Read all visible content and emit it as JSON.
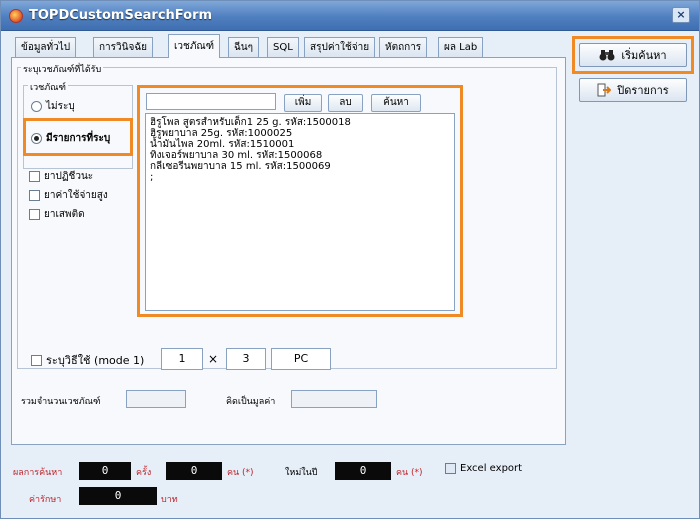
{
  "window": {
    "title": "TOPDCustomSearchForm",
    "close": "×"
  },
  "tabs": [
    {
      "label": "ข้อมูลทั่วไป"
    },
    {
      "label": "การวินิจฉัย"
    },
    {
      "label": "เวชภัณฑ์"
    },
    {
      "label": "ฉีนๆ"
    },
    {
      "label": "SQL"
    },
    {
      "label": "สรุปค่าใช้จ่าย"
    },
    {
      "label": "หัตถการ"
    },
    {
      "label": "ผล Lab"
    }
  ],
  "drug_panel": {
    "group_title": "ระบุเวชภัณฑ์ที่ได้รับ",
    "sub_group_title": "เวชภัณฑ์",
    "radio_none": "ไม่ระบุ",
    "radio_specified": "มีรายการที่ระบุ",
    "check_1": "ยาปฏิชีวนะ",
    "check_2": "ยาค่าใช้จ่ายสูง",
    "check_3": "ยาเสพติด",
    "search_value": "",
    "add_button": "เพิ่ม",
    "delete_button": "ลบ",
    "find_button": "ค้นหา",
    "items": [
      "ฮิรูโพล สูตรสำหรับเด็ก1 25 g. รหัส:1500018",
      "ฮิรูพยาบาล 25g. รหัส:1000025",
      "น้ำมันไพล 20ml. รหัส:1510001",
      "ทิงเจอร์พยาบาล 30 ml. รหัส:1500068",
      "กลีเซอรีนพยาบาล 15 ml. รหัส:1500069",
      ";"
    ]
  },
  "usage": {
    "label": "ระบุวิธีใช้ (mode 1)",
    "qty": "1",
    "times": "×",
    "value": "3",
    "unit": "PC"
  },
  "summary": {
    "total_label": "รวมจำนวนเวชภัณฑ์",
    "total_value": "",
    "money_label": "คิดเป็นมูลค่า",
    "money_value": ""
  },
  "side": {
    "search_button": "เริ่มค้นหา",
    "close_button": "ปิดรายการ"
  },
  "results": {
    "label": "ผลการค้นหา",
    "count_1": "0",
    "unit_1": "ครั้ง",
    "count_2": "0",
    "unit_2": "คน (*)",
    "new_label": "ใหม่ในปี",
    "count_3": "0",
    "unit_3": "คน (*)",
    "export_label": "Excel export",
    "cost_label": "ค่ารักษา",
    "cost_value": "0",
    "cost_unit": "บาท"
  },
  "colors": {
    "highlight": "#f08a24",
    "accent": "#4f7fbf"
  }
}
